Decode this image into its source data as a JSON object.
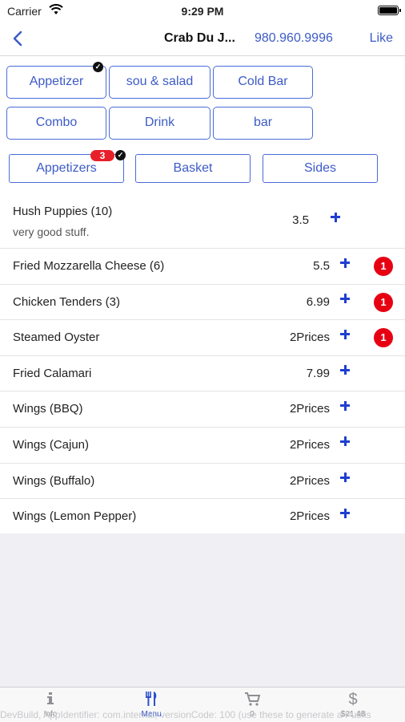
{
  "status_bar": {
    "carrier": "Carrier",
    "time": "9:29 PM"
  },
  "nav": {
    "title": "Crab Du J...",
    "phone": "980.960.9996",
    "like": "Like",
    "back_icon": "chevron-left-icon"
  },
  "categories": [
    {
      "label": "Appetizer",
      "selected": true
    },
    {
      "label": "sou & salad"
    },
    {
      "label": "Cold Bar"
    },
    {
      "label": "Combo"
    },
    {
      "label": "Drink"
    },
    {
      "label": "bar"
    }
  ],
  "subcategories": [
    {
      "label": "Appetizers",
      "count": "3",
      "selected": true
    },
    {
      "label": "Basket"
    },
    {
      "label": "Sides"
    }
  ],
  "items": [
    {
      "name": "Hush Puppies (10)",
      "description": "very good stuff.",
      "price": "3.5",
      "qty": ""
    },
    {
      "name": "Fried Mozzarella Cheese (6)",
      "price": "5.5",
      "qty": "1"
    },
    {
      "name": "Chicken Tenders (3)",
      "price": "6.99",
      "qty": "1"
    },
    {
      "name": "Steamed Oyster",
      "price": "2Prices",
      "qty": "1"
    },
    {
      "name": "Fried Calamari",
      "price": "7.99",
      "qty": ""
    },
    {
      "name": "Wings (BBQ)",
      "price": "2Prices",
      "qty": ""
    },
    {
      "name": "Wings (Cajun)",
      "price": "2Prices",
      "qty": ""
    },
    {
      "name": "Wings (Buffalo)",
      "price": "2Prices",
      "qty": ""
    },
    {
      "name": "Wings (Lemon Pepper)",
      "price": "2Prices",
      "qty": ""
    }
  ],
  "tabs": [
    {
      "label": "Info",
      "icon": "info-icon"
    },
    {
      "label": "Menu",
      "icon": "utensils-icon",
      "active": true
    },
    {
      "label": "0",
      "icon": "cart-icon"
    },
    {
      "label": "$21.48",
      "icon": "dollar-icon"
    }
  ],
  "watermark": "DevBuild, AppIdentifier: com.internal, versionCode: 100 (use these to generate a Publis",
  "colors": {
    "accent": "#3d5bc6",
    "badge": "#e60012",
    "plus": "#1f3fd0"
  }
}
